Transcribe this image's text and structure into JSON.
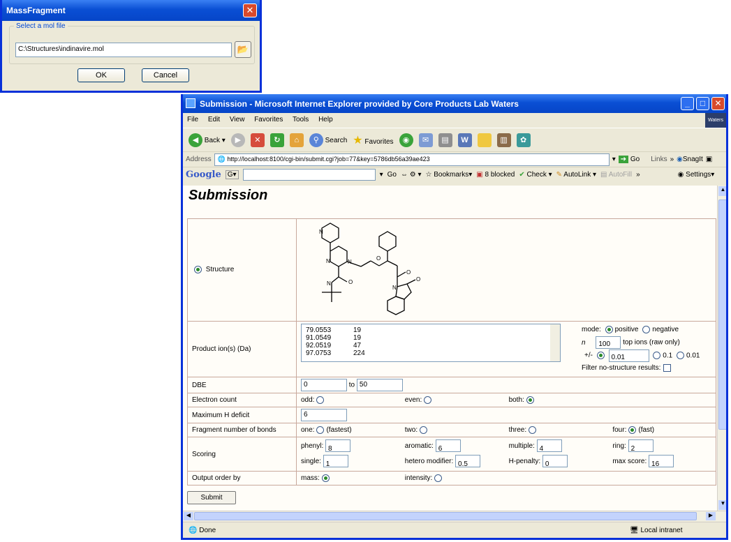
{
  "dialog": {
    "title": "MassFragment",
    "group_label": "Select a mol file",
    "file_path": "C:\\Structures\\indinavire.mol",
    "ok_label": "OK",
    "cancel_label": "Cancel"
  },
  "browser": {
    "title": "Submission - Microsoft Internet Explorer provided by Core Products Lab Waters",
    "menu": [
      "File",
      "Edit",
      "View",
      "Favorites",
      "Tools",
      "Help"
    ],
    "brand": "Waters",
    "toolbar": {
      "back": "Back",
      "search": "Search",
      "favorites": "Favorites"
    },
    "address_label": "Address",
    "url": "http://localhost:8100/cgi-bin/submit.cgi?job=77&key=5786db56a39ae423",
    "go_label": "Go",
    "links_label": "Links",
    "snagit_label": "SnagIt",
    "google": {
      "logo": "Google",
      "go": "Go",
      "bookmarks": "Bookmarks",
      "blocked": "8 blocked",
      "check": "Check",
      "autolink": "AutoLink",
      "autofill": "AutoFill",
      "settings": "Settings"
    },
    "status": "Done",
    "zone": "Local intranet"
  },
  "page": {
    "title": "Submission",
    "structure_label": "Structure",
    "product_ions_label": "Product ion(s) (Da)",
    "ions": [
      [
        "79.0553",
        "19"
      ],
      [
        "91.0549",
        "19"
      ],
      [
        "92.0519",
        "47"
      ],
      [
        "97.0753",
        "224"
      ]
    ],
    "mode_label": "mode:",
    "mode_positive": "positive",
    "mode_negative": "negative",
    "n_label": "n",
    "n_value": "100",
    "top_ions_label": "top ions (raw only)",
    "tol_label": "+/-",
    "tol_value": "0.01",
    "tol_opt1": "0.1",
    "tol_opt2": "0.01",
    "filter_label": "Filter no-structure results:",
    "dbe_label": "DBE",
    "dbe_from": "0",
    "dbe_to_label": "to",
    "dbe_to": "50",
    "electron_label": "Electron count",
    "odd_label": "odd:",
    "even_label": "even:",
    "both_label": "both:",
    "maxh_label": "Maximum H deficit",
    "maxh_value": "6",
    "bonds_label": "Fragment number of bonds",
    "one_label": "one:",
    "one_note": "(fastest)",
    "two_label": "two:",
    "three_label": "three:",
    "four_label": "four:",
    "four_note": "(fast)",
    "scoring_label": "Scoring",
    "phenyl_label": "phenyl:",
    "phenyl_value": "8",
    "aromatic_label": "aromatic:",
    "aromatic_value": "6",
    "multiple_label": "multiple:",
    "multiple_value": "4",
    "ring_label": "ring:",
    "ring_value": "2",
    "single_label": "single:",
    "single_value": "1",
    "hetero_label": "hetero modifier:",
    "hetero_value": "0.5",
    "hpenalty_label": "H-penalty:",
    "hpenalty_value": "0",
    "maxscore_label": "max score:",
    "maxscore_value": "16",
    "output_label": "Output order by",
    "mass_label": "mass:",
    "intensity_label": "intensity:",
    "submit_label": "Submit"
  }
}
